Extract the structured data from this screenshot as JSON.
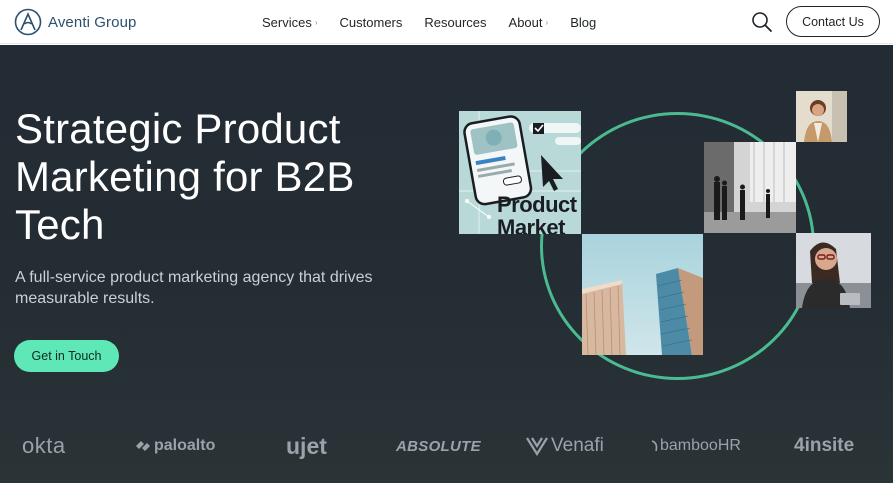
{
  "nav": {
    "brand": "Aventi Group",
    "items": [
      {
        "label": "Services",
        "has_caret": true
      },
      {
        "label": "Customers",
        "has_caret": false
      },
      {
        "label": "Resources",
        "has_caret": false
      },
      {
        "label": "About",
        "has_caret": true
      },
      {
        "label": "Blog",
        "has_caret": false
      }
    ],
    "caret": "›",
    "search_icon": "search-icon",
    "contact_label": "Contact Us"
  },
  "hero": {
    "headline": "Strategic Product Marketing for B2B Tech",
    "subtitle": "A full-service product marketing agency that drives measurable results.",
    "cta_label": "Get in Touch",
    "tile_phone_text_1": "Product",
    "tile_phone_text_2": "Market"
  },
  "logos": [
    "okta",
    "paloalto",
    "ujet",
    "ABSOLUTE",
    "Venafi",
    "bambooHR",
    "4insite"
  ],
  "colors": {
    "accent": "#5ee8b7",
    "hero_bg": "#242d33",
    "brand_text": "#2b5070",
    "logo_gray": "#9aa2aa"
  }
}
